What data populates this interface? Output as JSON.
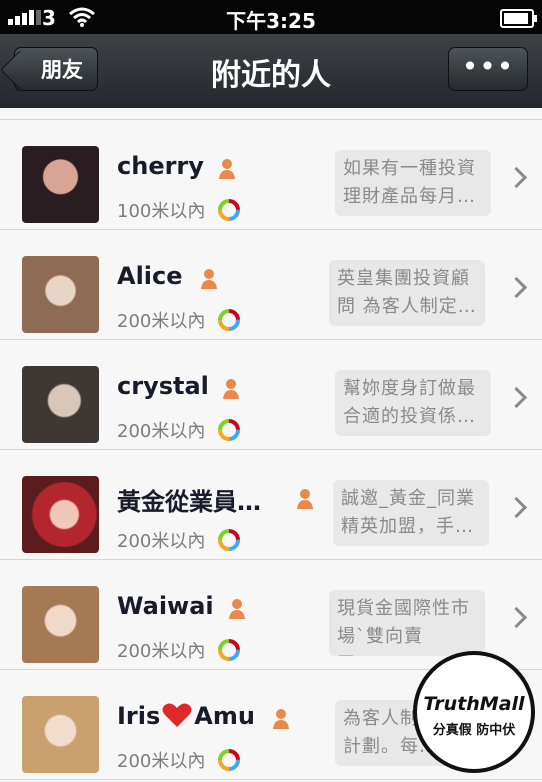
{
  "status_bar": {
    "carrier": "3",
    "time": "下午3:25"
  },
  "nav": {
    "title": "附近的人",
    "back_label": "朋友",
    "more_label": "•••"
  },
  "people": [
    {
      "name": "cherry",
      "distance": "100米以內",
      "signature": "如果有一種投資理財產品每月…"
    },
    {
      "name": "Alice",
      "distance": "200米以內",
      "signature": "英皇集團投資顧問 為客人制定…"
    },
    {
      "name": "crystal",
      "distance": "200米以內",
      "signature": "幫妳度身訂做最合適的投資係…"
    },
    {
      "name": "黃金從業員…",
      "distance": "200米以內",
      "signature": "誠邀_黃金_同業精英加盟，手…"
    },
    {
      "name": "Waiwai",
      "distance": "200米以內",
      "signature": "現貨金國際性市場`雙向賣買！…"
    },
    {
      "name_prefix": "Iris",
      "name_suffix": "Amu",
      "distance": "200米以內",
      "signature": "為客人制定個人計劃。每…"
    }
  ],
  "watermark": {
    "brand": "TruthMall",
    "slogan": "分真假 防中伏"
  },
  "icons": {
    "gender": "person-female-icon",
    "moments": "album-color-icon",
    "row_arrow": "chevron-right-icon",
    "heart": "heart-emoji-icon"
  },
  "colors": {
    "navbar": "#2c3034",
    "accent_orange": "#e98a4d",
    "text_name": "#1a1a2a"
  }
}
